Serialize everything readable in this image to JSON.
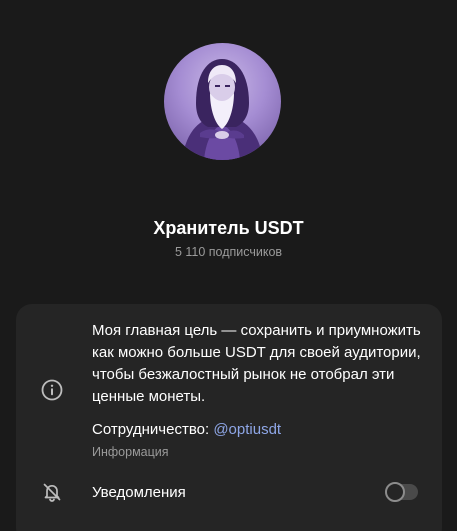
{
  "channel": {
    "title": "Хранитель USDT",
    "subscribers": "5 110 подписчиков"
  },
  "info": {
    "description": "Моя главная цель — сохранить и приумножить как можно больше USDT для своей аудитории, чтобы безжалостный рынок не отобрал эти ценные монеты.",
    "collab_label": "Сотрудничество: ",
    "collab_handle": "@optiusdt",
    "section_label": "Информация"
  },
  "notifications": {
    "label": "Уведомления",
    "enabled": false
  },
  "icons": {
    "info": "info-circle-icon",
    "bell": "bell-off-icon"
  },
  "colors": {
    "background": "#1a1a1a",
    "card": "#252525",
    "link": "#8ea6e6",
    "secondary_text": "#9a9a9a"
  }
}
